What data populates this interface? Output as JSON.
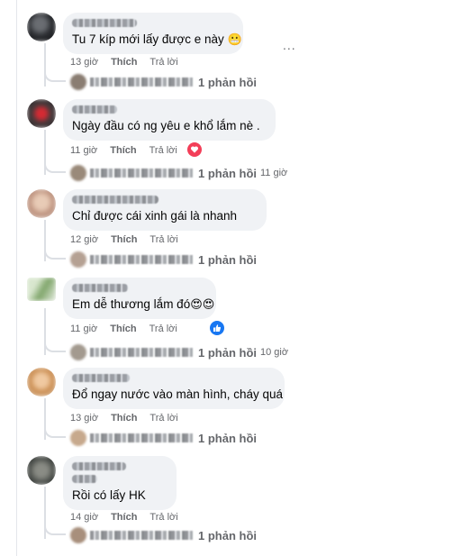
{
  "comments": [
    {
      "avatar_color": "#2b2d31",
      "text": "Tu 7 kíp mới lấy được e này",
      "emoji": "😬",
      "time": "13 giờ",
      "like": "Thích",
      "reply": "Trả lời",
      "replies": "1 phản hồi",
      "reply_time": "",
      "reaction": ""
    },
    {
      "avatar_color": "#c0232b",
      "text": "Ngày đầu có ng yêu e khổ lắm nè .",
      "emoji": "",
      "time": "11 giờ",
      "like": "Thích",
      "reply": "Trả lời",
      "replies": "1 phản hồi",
      "reply_time": "11 giờ",
      "reaction": "love"
    },
    {
      "avatar_color": "#c9a793",
      "text": "Chỉ được cái xinh gái là nhanh",
      "emoji": "",
      "time": "12 giờ",
      "like": "Thích",
      "reply": "Trả lời",
      "replies": "1 phản hồi",
      "reply_time": "",
      "reaction": ""
    },
    {
      "avatar_color": "#7fa56a",
      "text": "Em dễ thương lắm đó",
      "emoji": "😍😍",
      "time": "11 giờ",
      "like": "Thích",
      "reply": "Trả lời",
      "replies": "1 phản hồi",
      "reply_time": "10 giờ",
      "reaction": "like"
    },
    {
      "avatar_color": "#c98b4e",
      "text": "Đổ ngay nước vào màn hình, cháy quá",
      "emoji": "",
      "time": "13 giờ",
      "like": "Thích",
      "reply": "Trả lời",
      "replies": "1 phản hồi",
      "reply_time": "",
      "reaction": ""
    },
    {
      "avatar_color": "#4b4f4b",
      "text": "Rồi có lấy HK",
      "emoji": "",
      "time": "14 giờ",
      "like": "Thích",
      "reply": "Trả lời",
      "replies": "1 phản hồi",
      "reply_time": "",
      "reaction": ""
    }
  ],
  "more_label": "...",
  "colors": {
    "bubble": "#f0f2f5",
    "meta": "#65676b",
    "love": "#f33e58",
    "like": "#1877f2"
  }
}
